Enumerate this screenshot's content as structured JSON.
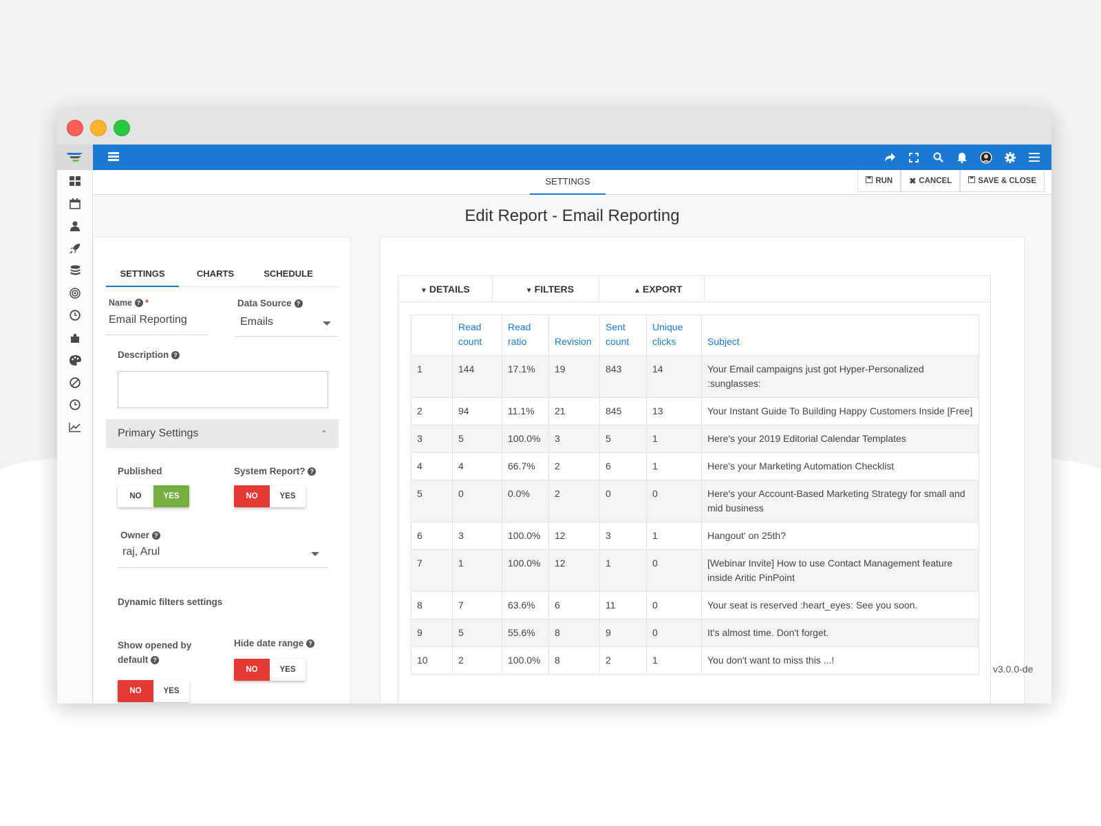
{
  "subbar": {
    "tab": "SETTINGS",
    "actions": {
      "run": "RUN",
      "cancel": "CANCEL",
      "save_close": "SAVE & CLOSE"
    }
  },
  "page_title": "Edit Report - Email Reporting",
  "topbar_icons": [
    "share-icon",
    "fullscreen-icon",
    "search-icon",
    "bell-icon",
    "avatar",
    "gear-icon",
    "menu-icon"
  ],
  "sidebar_icons": [
    "dashboard-icon",
    "calendar-icon",
    "user-icon",
    "rocket-icon",
    "database-icon",
    "target-icon",
    "clock-icon",
    "puzzle-icon",
    "palette-icon",
    "ban-icon",
    "clock-icon",
    "chart-line-icon"
  ],
  "settings_panel": {
    "tabs": [
      "SETTINGS",
      "CHARTS",
      "SCHEDULE"
    ],
    "name": {
      "label": "Name",
      "required_mark": "*",
      "value": "Email Reporting"
    },
    "data_source": {
      "label": "Data Source",
      "value": "Emails"
    },
    "description": {
      "label": "Description",
      "value": ""
    },
    "primary_settings": "Primary Settings",
    "published": {
      "label": "Published",
      "no": "NO",
      "yes": "YES",
      "selected": "YES"
    },
    "system_report": {
      "label": "System Report?",
      "no": "NO",
      "yes": "YES",
      "selected": "NO"
    },
    "owner": {
      "label": "Owner",
      "value": "raj, Arul"
    },
    "dynamic_filters": "Dynamic filters settings",
    "show_opened": {
      "label_line1": "Show opened by",
      "label_line2": "default",
      "no": "NO",
      "yes": "YES",
      "selected": "NO"
    },
    "hide_date_range": {
      "label": "Hide date range",
      "no": "NO",
      "yes": "YES",
      "selected": "NO"
    }
  },
  "report": {
    "toolbar": [
      "DETAILS",
      "FILTERS",
      "EXPORT"
    ],
    "columns": [
      {
        "line1": "",
        "line2": ""
      },
      {
        "line1": "Read",
        "line2": "count"
      },
      {
        "line1": "Read",
        "line2": "ratio"
      },
      {
        "line1": "",
        "line2": "Revision"
      },
      {
        "line1": "Sent",
        "line2": "count"
      },
      {
        "line1": "Unique",
        "line2": "clicks"
      },
      {
        "line1": "",
        "line2": "Subject"
      }
    ],
    "rows": [
      [
        "1",
        "144",
        "17.1%",
        "19",
        "843",
        "14",
        "Your Email campaigns just got Hyper-Personalized :sunglasses:"
      ],
      [
        "2",
        "94",
        "11.1%",
        "21",
        "845",
        "13",
        "Your Instant Guide To Building Happy Customers Inside [Free]"
      ],
      [
        "3",
        "5",
        "100.0%",
        "3",
        "5",
        "1",
        "Here's your 2019 Editorial Calendar Templates"
      ],
      [
        "4",
        "4",
        "66.7%",
        "2",
        "6",
        "1",
        "Here's your Marketing Automation Checklist"
      ],
      [
        "5",
        "0",
        "0.0%",
        "2",
        "0",
        "0",
        "Here's your Account-Based Marketing Strategy for small and mid business"
      ],
      [
        "6",
        "3",
        "100.0%",
        "12",
        "3",
        "1",
        "Hangout' on 25th?"
      ],
      [
        "7",
        "1",
        "100.0%",
        "12",
        "1",
        "0",
        "[Webinar Invite] How to use Contact Management feature inside Aritic PinPoint"
      ],
      [
        "8",
        "7",
        "63.6%",
        "6",
        "11",
        "0",
        "Your seat is reserved :heart_eyes: See you soon."
      ],
      [
        "9",
        "5",
        "55.6%",
        "8",
        "9",
        "0",
        "It's almost time. Don't forget."
      ],
      [
        "10",
        "2",
        "100.0%",
        "8",
        "2",
        "1",
        "You don't want to miss this ...!"
      ]
    ]
  },
  "version": "v3.0.0-de",
  "colors": {
    "topbar": "#1a7ad3",
    "yes_green": "#76b041",
    "no_red": "#e53935"
  }
}
